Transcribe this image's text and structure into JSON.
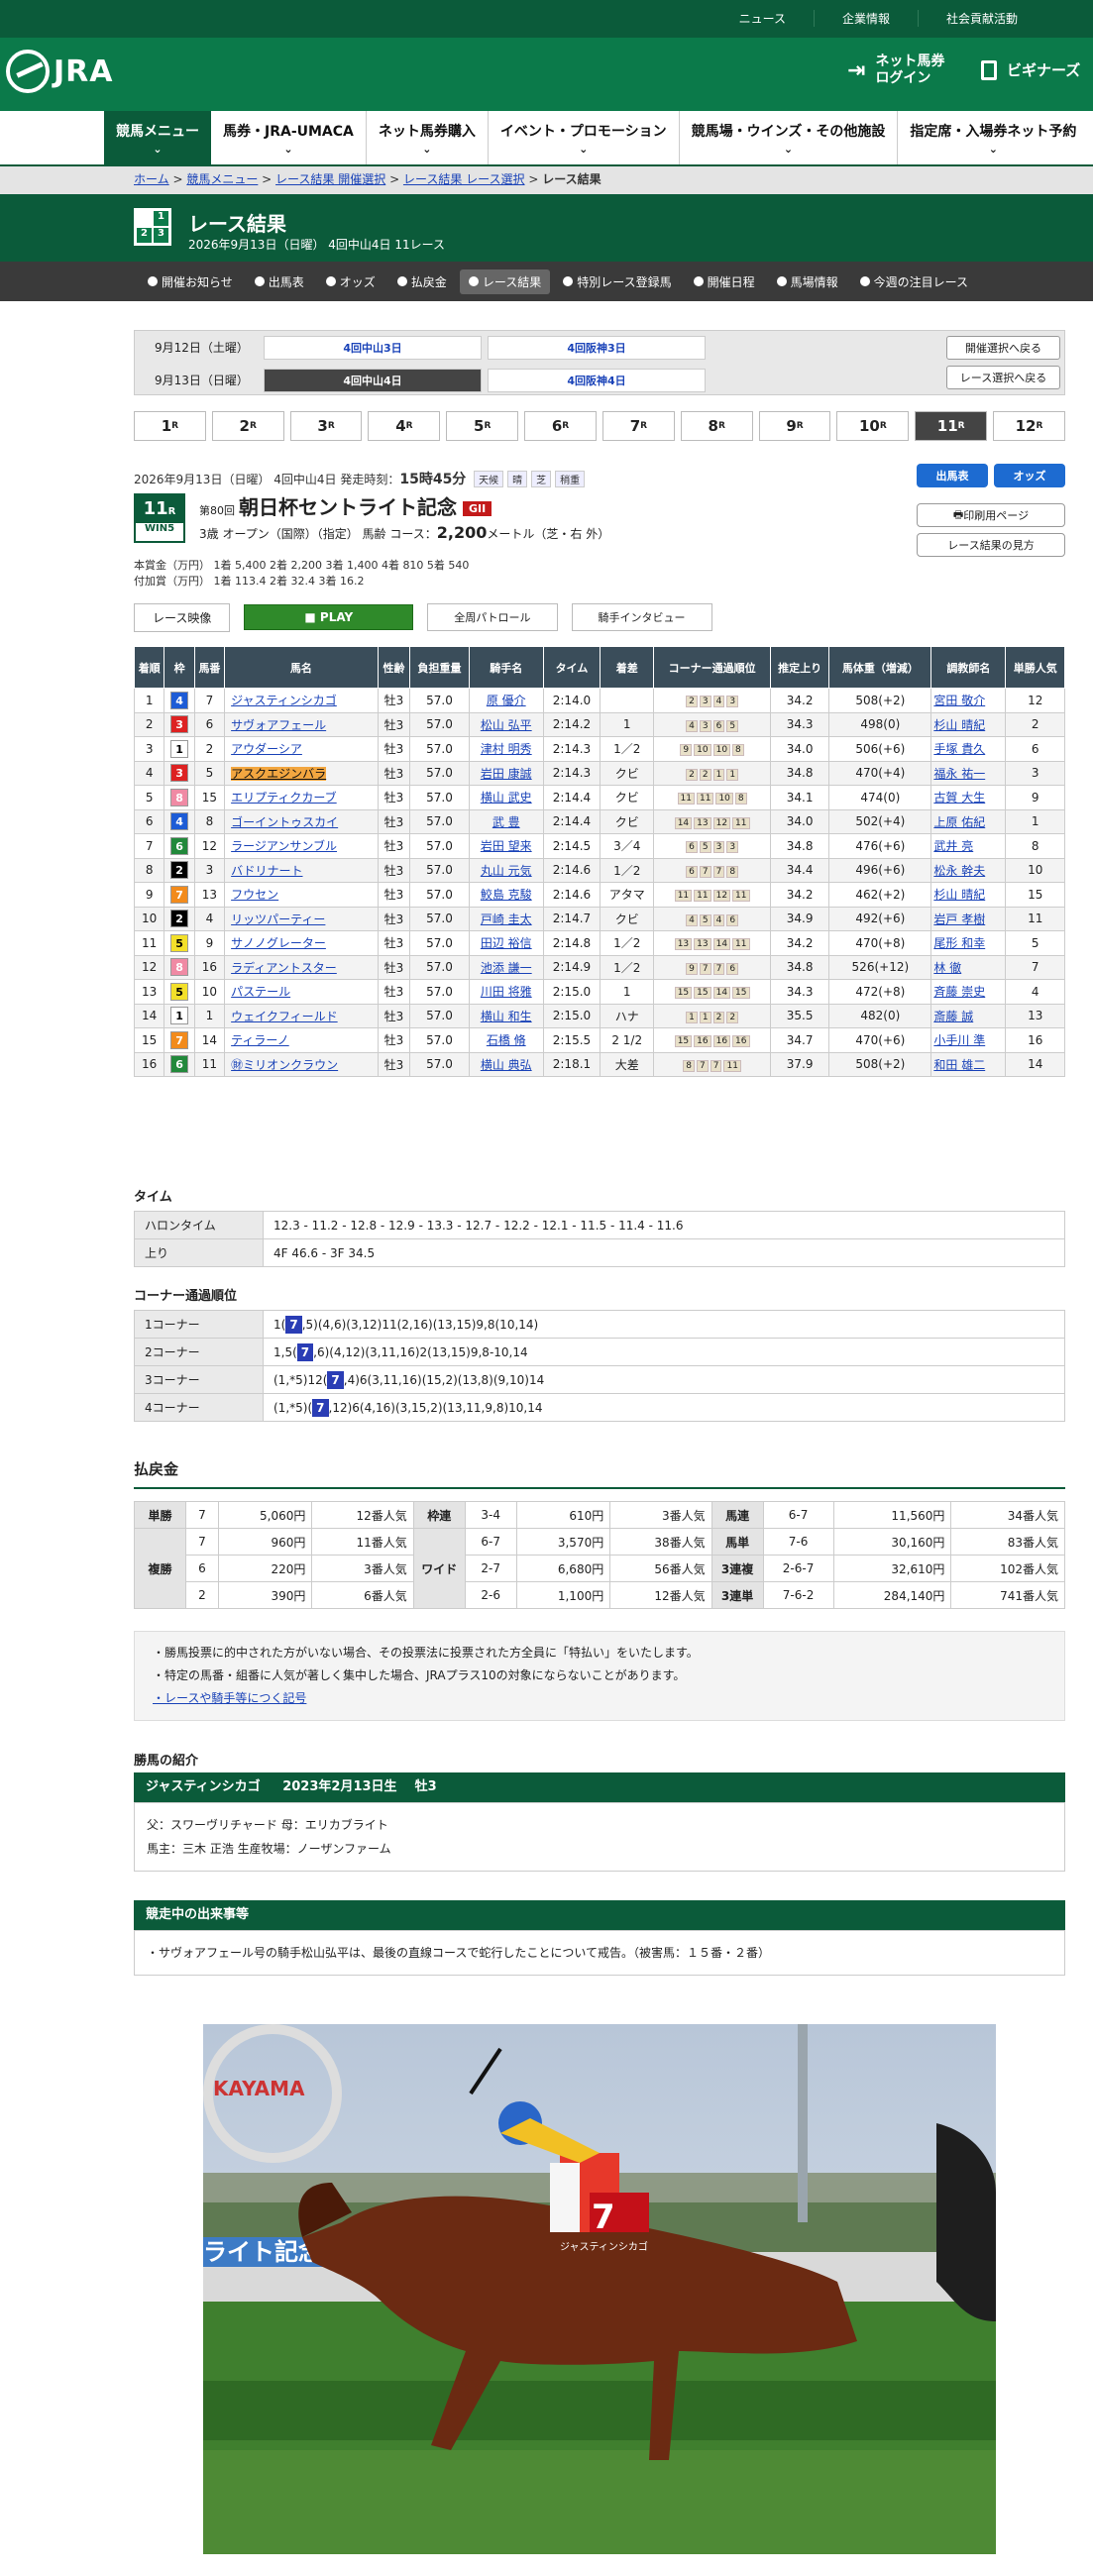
{
  "top_links": [
    "ニュース",
    "企業情報",
    "社会貢献活動"
  ],
  "header": {
    "logo": "JRA",
    "login": "ネット馬券\nログイン",
    "beginners": "ビギナーズ"
  },
  "gnav": [
    "競馬メニュー",
    "馬券・JRA-UMACA",
    "ネット馬券購入",
    "イベント・プロモーション",
    "競馬場・ウインズ・その他施設",
    "指定席・入場券ネット予約"
  ],
  "breadcrumb": [
    "ホーム",
    "競馬メニュー",
    "レース結果 開催選択",
    "レース結果 レース選択",
    "レース結果"
  ],
  "title": {
    "main": "レース結果",
    "sub": "2026年9月13日（日曜） 4回中山4日 11レース"
  },
  "subnav": [
    "開催お知らせ",
    "出馬表",
    "オッズ",
    "払戻金",
    "レース結果",
    "特別レース登録馬",
    "開催日程",
    "馬場情報",
    "今週の注目レース"
  ],
  "dates": [
    {
      "label": "9月12日（土曜）",
      "venues": [
        "4回中山3日",
        "4回阪神3日"
      ]
    },
    {
      "label": "9月13日（日曜）",
      "venues": [
        "4回中山4日",
        "4回阪神4日"
      ]
    }
  ],
  "side_buttons": [
    "開催選択へ戻る",
    "レース選択へ戻る"
  ],
  "races": [
    "1",
    "2",
    "3",
    "4",
    "5",
    "6",
    "7",
    "8",
    "9",
    "10",
    "11",
    "12"
  ],
  "race_unit": "R",
  "race": {
    "meta": "2026年9月13日（日曜） 4回中山4日  発走時刻：",
    "start": "15時45分",
    "tags": [
      "天候",
      "晴",
      "芝",
      "稍重"
    ],
    "num": "11",
    "num_unit": "R",
    "win5": "WIN5",
    "no": "第80回",
    "name": "朝日杯セントライト記念",
    "grade": "GII",
    "cond": "3歳  オープン（国際）（指定）  馬齢    コース：",
    "dist": "2,200",
    "course": "メートル（芝・右 外）",
    "prize": "本賞金（万円）  1着  5,400  2着  2,200  3着  1,400  4着  810  5着  540",
    "addprize": "付加賞（万円）  1着  113.4  2着  32.4  3着  16.2"
  },
  "race_buttons": [
    "出馬表",
    "オッズ",
    "印刷用ページ",
    "レース結果の見方"
  ],
  "video": [
    "レース映像",
    "PLAY",
    "全周パトロール",
    "騎手インタビュー"
  ],
  "headers": [
    "着順",
    "枠",
    "馬番",
    "馬名",
    "性齢",
    "負担重量",
    "騎手名",
    "タイム",
    "着差",
    "コーナー通過順位",
    "推定上り",
    "馬体重（増減）",
    "調教師名",
    "単勝人気"
  ],
  "results": [
    [
      "1",
      "4",
      "7",
      "ジャスティンシカゴ",
      "牡3",
      "57.0",
      "原 優介",
      "2:14.0",
      "",
      "2 3 4 3",
      "34.2",
      "508(+2)",
      "宮田 敬介",
      "12"
    ],
    [
      "2",
      "3",
      "6",
      "サヴォアフェール",
      "牡3",
      "57.0",
      "松山 弘平",
      "2:14.2",
      "1",
      "4 3 6 5",
      "34.3",
      "498(0)",
      "杉山 晴紀",
      "2"
    ],
    [
      "3",
      "1",
      "2",
      "アウダーシア",
      "牡3",
      "57.0",
      "津村 明秀",
      "2:14.3",
      "1／2",
      "9 10 10 8",
      "34.0",
      "506(+6)",
      "手塚 貴久",
      "6"
    ],
    [
      "4",
      "3",
      "5",
      "アスクエジンバラ",
      "牡3",
      "57.0",
      "岩田 康誠",
      "2:14.3",
      "クビ",
      "2 2 1 1",
      "34.8",
      "470(+4)",
      "福永 祐一",
      "3"
    ],
    [
      "5",
      "8",
      "15",
      "エリプティクカーブ",
      "牡3",
      "57.0",
      "横山 武史",
      "2:14.4",
      "クビ",
      "11 11 10 8",
      "34.1",
      "474(0)",
      "古賀 大生",
      "9"
    ],
    [
      "6",
      "4",
      "8",
      "ゴーイントゥスカイ",
      "牡3",
      "57.0",
      "武 豊",
      "2:14.4",
      "クビ",
      "14 13 12 11",
      "34.0",
      "502(+4)",
      "上原 佑紀",
      "1"
    ],
    [
      "7",
      "6",
      "12",
      "ラージアンサンブル",
      "牡3",
      "57.0",
      "岩田 望来",
      "2:14.5",
      "3／4",
      "6 5 3 3",
      "34.8",
      "476(+6)",
      "武井 亮",
      "8"
    ],
    [
      "8",
      "2",
      "3",
      "バドリナート",
      "牡3",
      "57.0",
      "丸山 元気",
      "2:14.6",
      "1／2",
      "6 7 7 8",
      "34.4",
      "496(+6)",
      "松永 幹夫",
      "10"
    ],
    [
      "9",
      "7",
      "13",
      "フウセン",
      "牡3",
      "57.0",
      "鮫島 克駿",
      "2:14.6",
      "アタマ",
      "11 11 12 11",
      "34.2",
      "462(+2)",
      "杉山 晴紀",
      "15"
    ],
    [
      "10",
      "2",
      "4",
      "リッツパーティー",
      "牡3",
      "57.0",
      "戸崎 圭太",
      "2:14.7",
      "クビ",
      "4 5 4 6",
      "34.9",
      "492(+6)",
      "岩戸 孝樹",
      "11"
    ],
    [
      "11",
      "5",
      "9",
      "サノノグレーター",
      "牡3",
      "57.0",
      "田辺 裕信",
      "2:14.8",
      "1／2",
      "13 13 14 11",
      "34.2",
      "470(+8)",
      "尾形 和幸",
      "5"
    ],
    [
      "12",
      "8",
      "16",
      "ラディアントスター",
      "牡3",
      "57.0",
      "池添 謙一",
      "2:14.9",
      "1／2",
      "9 7 7 6",
      "34.8",
      "526(+12)",
      "林 徹",
      "7"
    ],
    [
      "13",
      "5",
      "10",
      "パステール",
      "牡3",
      "57.0",
      "川田 将雅",
      "2:15.0",
      "1",
      "15 15 14 15",
      "34.3",
      "472(+8)",
      "斉藤 崇史",
      "4"
    ],
    [
      "14",
      "1",
      "1",
      "ウェイクフィールド",
      "牡3",
      "57.0",
      "横山 和生",
      "2:15.0",
      "ハナ",
      "1 1 2 2",
      "35.5",
      "482(0)",
      "斎藤 誠",
      "13"
    ],
    [
      "15",
      "7",
      "14",
      "ティラーノ",
      "牡3",
      "57.0",
      "石橋 脩",
      "2:15.5",
      "2 1/2",
      "15 16 16 16",
      "34.7",
      "470(+6)",
      "小手川 準",
      "16"
    ],
    [
      "16",
      "6",
      "11",
      "㊖ミリオンクラウン",
      "牡3",
      "57.0",
      "横山 典弘",
      "2:18.1",
      "大差",
      "8 7 7 11",
      "37.9",
      "508(+2)",
      "和田 雄二",
      "14"
    ]
  ],
  "time_section": {
    "title": "タイム",
    "rows": [
      [
        "ハロンタイム",
        "12.3 - 11.2 - 12.8 - 12.9 - 13.3 - 12.7 - 12.2 - 12.1 - 11.5 - 11.4 - 11.6"
      ],
      [
        "上り",
        "4F 46.6 - 3F 34.5"
      ]
    ]
  },
  "corner_section": {
    "title": "コーナー通過順位",
    "rows": [
      [
        "1コーナー",
        "1(",
        "7",
        ",5)(4,6)(3,12)11(2,16)(13,15)9,8(10,14)"
      ],
      [
        "2コーナー",
        "1,5(",
        "7",
        ",6)(4,12)(3,11,16)2(13,15)9,8-10,14"
      ],
      [
        "3コーナー",
        "(1,*5)12(",
        "7",
        ",4)6(3,11,16)(15,2)(13,8)(9,10)14"
      ],
      [
        "4コーナー",
        "(1,*5)(",
        "7",
        ",12)6(4,16)(3,15,2)(13,11,9,8)10,14"
      ]
    ]
  },
  "payout_title": "払戻金",
  "payouts": {
    "tansho": {
      "label": "単勝",
      "rows": [
        [
          "7",
          "5,060円",
          "12番人気"
        ]
      ]
    },
    "fukusho": {
      "label": "複勝",
      "rows": [
        [
          "7",
          "960円",
          "11番人気"
        ],
        [
          "6",
          "220円",
          "3番人気"
        ],
        [
          "2",
          "390円",
          "6番人気"
        ]
      ]
    },
    "wakuren": {
      "label": "枠連",
      "rows": [
        [
          "3-4",
          "610円",
          "3番人気"
        ]
      ]
    },
    "wide": {
      "label": "ワイド",
      "rows": [
        [
          "6-7",
          "3,570円",
          "38番人気"
        ],
        [
          "2-7",
          "6,680円",
          "56番人気"
        ],
        [
          "2-6",
          "1,100円",
          "12番人気"
        ]
      ]
    },
    "umaren": {
      "label": "馬連",
      "rows": [
        [
          "6-7",
          "11,560円",
          "34番人気"
        ]
      ]
    },
    "umatan": {
      "label": "馬単",
      "rows": [
        [
          "7-6",
          "30,160円",
          "83番人気"
        ]
      ]
    },
    "sanrenpuku": {
      "label": "3連複",
      "rows": [
        [
          "2-6-7",
          "32,610円",
          "102番人気"
        ]
      ]
    },
    "sanrentan": {
      "label": "3連単",
      "rows": [
        [
          "7-6-2",
          "284,140円",
          "741番人気"
        ]
      ]
    }
  },
  "notes": [
    "・勝馬投票に的中された方がいない場合、その投票法に投票された方全員に「特払い」をいたします。",
    "・特定の馬番・組番に人気が著しく集中した場合、JRAプラス10の対象にならないことがあります。",
    "・レースや騎手等につく記号"
  ],
  "winner_title": "勝馬の紹介",
  "winner": {
    "name": "ジャスティンシカゴ",
    "born": "2023年2月13日生",
    "sexage": "牡3",
    "sire": "父：スワーヴリチャード    母：エリカブライト",
    "owner": "馬主：三木 正浩    生産牧場：ノーザンファーム"
  },
  "incident_title": "競走中の出来事等",
  "incident": "・サヴォアフェール号の騎手松山弘平は、最後の直線コースで蛇行したことについて戒告。（被害馬：１５番・２番）",
  "photo": {
    "jockey_number": "7",
    "banner": "ライト記念(GII)",
    "name_on_cloth": "ジャスティンシカゴ",
    "sign": "KAYAMA"
  },
  "colors": {
    "jra_green": "#0b7a4a",
    "dark_green": "#0b5b3a",
    "grade_red": "#c31a1a",
    "corner_hl": "#2a3db5"
  }
}
